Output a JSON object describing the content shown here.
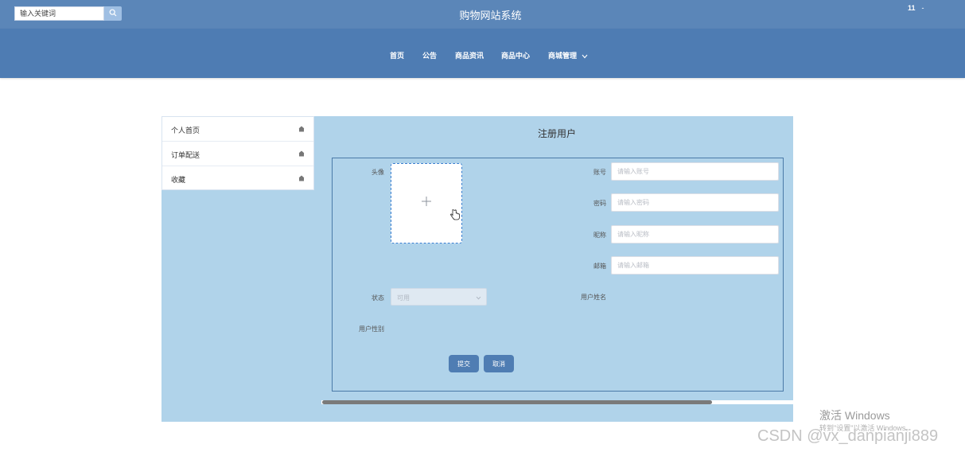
{
  "header": {
    "search_placeholder": "输入关键词",
    "site_title": "购物网站系统",
    "username": "11",
    "user_dash": "-"
  },
  "nav": {
    "items": [
      {
        "label": "首页"
      },
      {
        "label": "公告"
      },
      {
        "label": "商品资讯"
      },
      {
        "label": "商品中心"
      },
      {
        "label": "商城管理"
      }
    ]
  },
  "sidebar": {
    "items": [
      {
        "label": "个人首页"
      },
      {
        "label": "订单配送"
      },
      {
        "label": "收藏"
      }
    ]
  },
  "form": {
    "title": "注册用户",
    "avatar_label": "头像",
    "account_label": "账号",
    "account_placeholder": "请输入账号",
    "password_label": "密码",
    "password_placeholder": "请输入密码",
    "nickname_label": "昵称",
    "nickname_placeholder": "请输入昵称",
    "email_label": "邮箱",
    "email_placeholder": "请输入邮箱",
    "status_label": "状态",
    "status_value": "可用",
    "realname_label": "用户姓名",
    "gender_label": "用户性别",
    "submit_label": "提交",
    "cancel_label": "取消"
  },
  "overlay": {
    "activate_title": "激活 Windows",
    "activate_sub": "转到\"设置\"以激活 Windows。",
    "csdn": "CSDN @vx_danpianji889"
  },
  "colors": {
    "topbar": "#5b86b8",
    "navbar": "#4e7cb3",
    "panel": "#b0d3ea",
    "button": "#4f7db3"
  }
}
